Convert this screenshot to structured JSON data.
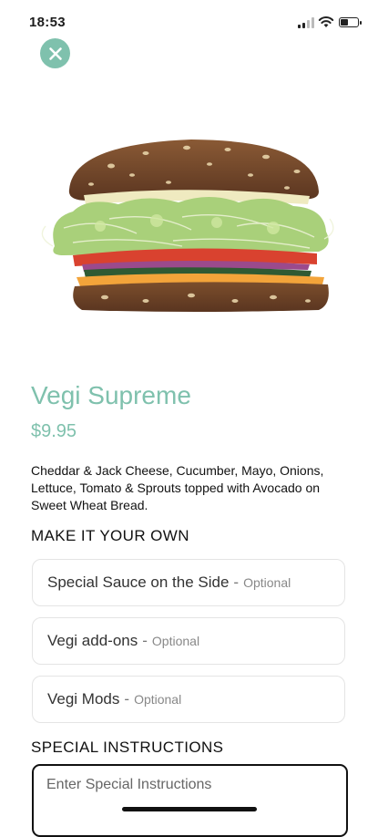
{
  "status_bar": {
    "time": "18:53"
  },
  "item": {
    "name": "Vegi Supreme",
    "price": "$9.95",
    "description": "Cheddar & Jack Cheese, Cucumber, Mayo, Onions, Lettuce, Tomato & Sprouts topped with Avocado on Sweet Wheat Bread."
  },
  "customize": {
    "heading": "MAKE IT YOUR OWN",
    "options": [
      {
        "label": "Special Sauce on the Side",
        "separator": "-",
        "tag": "Optional"
      },
      {
        "label": "Vegi add-ons",
        "separator": "-",
        "tag": "Optional"
      },
      {
        "label": "Vegi Mods",
        "separator": "-",
        "tag": "Optional"
      }
    ]
  },
  "instructions": {
    "heading": "SPECIAL INSTRUCTIONS",
    "placeholder": "Enter Special Instructions"
  },
  "colors": {
    "accent": "#7fc1ad"
  },
  "icons": {
    "close": "close-icon",
    "signal": "cellular-signal-icon",
    "wifi": "wifi-icon",
    "battery": "battery-icon"
  }
}
